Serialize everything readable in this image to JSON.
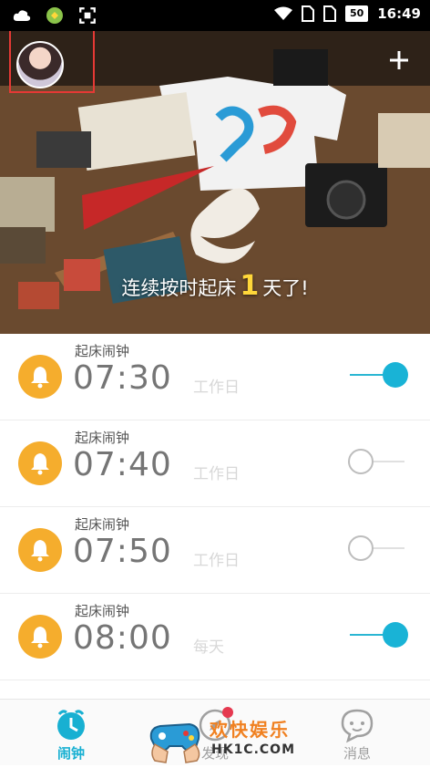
{
  "status_bar": {
    "battery": "50",
    "time": "16:49"
  },
  "hero": {
    "streak_prefix": "连续按时起床",
    "streak_count": "1",
    "streak_suffix": "天了!"
  },
  "alarms": [
    {
      "name": "起床闹钟",
      "time": "07:30",
      "repeat": "工作日",
      "enabled": true
    },
    {
      "name": "起床闹钟",
      "time": "07:40",
      "repeat": "工作日",
      "enabled": false
    },
    {
      "name": "起床闹钟",
      "time": "07:50",
      "repeat": "工作日",
      "enabled": false
    },
    {
      "name": "起床闹钟",
      "time": "08:00",
      "repeat": "每天",
      "enabled": true
    }
  ],
  "tabs": {
    "alarm": "闹钟",
    "find": "发现",
    "messages": "消息"
  },
  "watermark": {
    "line1": "欢快娱乐",
    "line2": "HK1C.COM"
  },
  "colors": {
    "accent": "#19b3d6",
    "bell": "#f5ad2d",
    "badge": "#e53950"
  }
}
